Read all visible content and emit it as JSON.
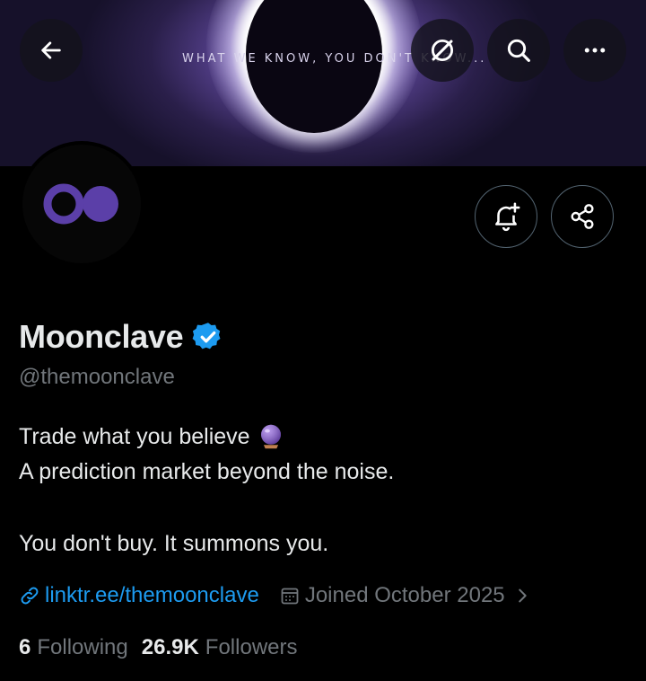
{
  "header": {
    "banner_text": "WHAT WE KNOW, YOU DON'T KNOW...",
    "back_icon": "arrow-left-icon",
    "actions": [
      "grok-icon",
      "search-icon",
      "more-icon"
    ]
  },
  "profile": {
    "display_name": "Moonclave",
    "handle": "@themoonclave",
    "verified": true,
    "bio_line1": "Trade what you believe",
    "bio_emoji": "crystal-ball-icon",
    "bio_line2": "A prediction market beyond the noise.",
    "bio_line3": "You don't buy. It summons you.",
    "link": "linktr.ee/themoonclave",
    "joined": "Joined October 2025"
  },
  "actions": {
    "notify_icon": "bell-plus-icon",
    "share_icon": "share-icon"
  },
  "stats": {
    "following_count": "6",
    "following_label": "Following",
    "followers_count": "26.9K",
    "followers_label": "Followers"
  },
  "colors": {
    "accent": "#1d9bf0",
    "muted": "#71767b",
    "brand_purple": "#5b3fa8"
  }
}
